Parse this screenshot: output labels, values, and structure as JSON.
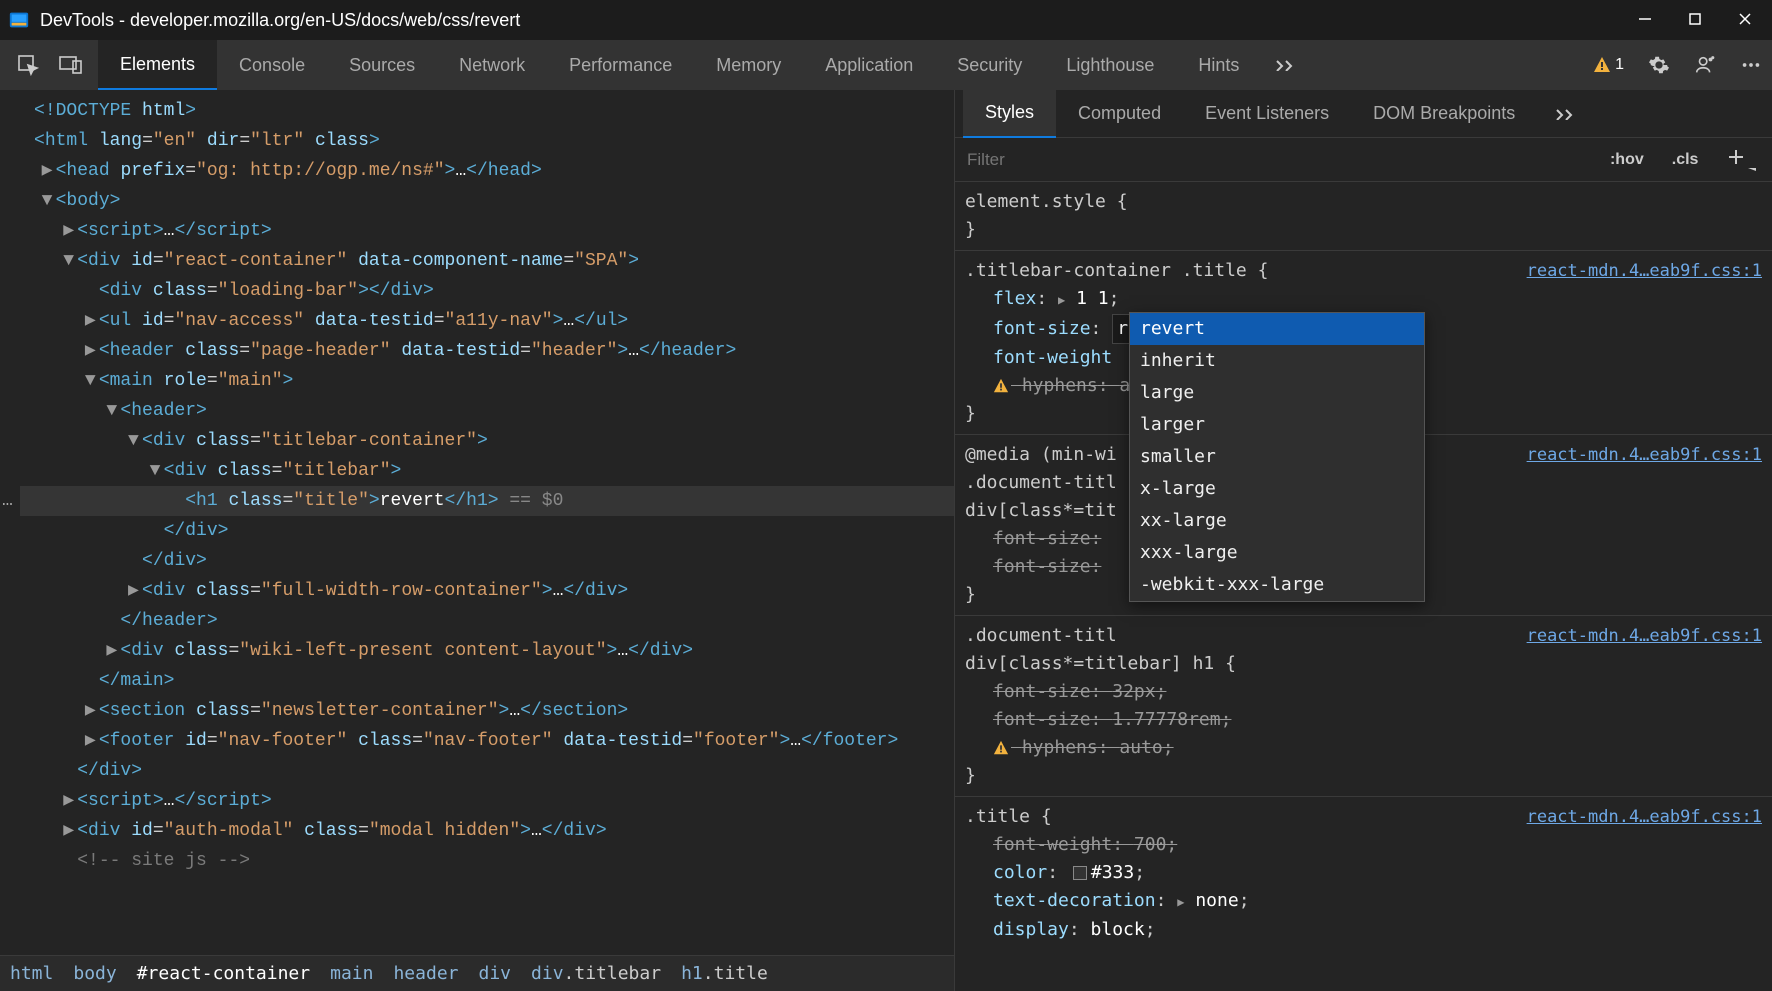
{
  "window": {
    "title": "DevTools - developer.mozilla.org/en-US/docs/web/css/revert"
  },
  "mainTabs": [
    "Elements",
    "Console",
    "Sources",
    "Network",
    "Performance",
    "Memory",
    "Application",
    "Security",
    "Lighthouse",
    "Hints"
  ],
  "mainTabsActive": 0,
  "issueCount": "1",
  "dom": [
    {
      "indent": 0,
      "arrow": "",
      "html": "<!DOCTYPE html>"
    },
    {
      "indent": 0,
      "arrow": "",
      "html": "<html lang=\"en\" dir=\"ltr\" class>"
    },
    {
      "indent": 1,
      "arrow": "▶",
      "html": "<head prefix=\"og: http://ogp.me/ns#\">…</head>"
    },
    {
      "indent": 1,
      "arrow": "▼",
      "html": "<body>"
    },
    {
      "indent": 2,
      "arrow": "▶",
      "html": "<script>…</script>"
    },
    {
      "indent": 2,
      "arrow": "▼",
      "html": "<div id=\"react-container\" data-component-name=\"SPA\">"
    },
    {
      "indent": 3,
      "arrow": "",
      "html": "<div class=\"loading-bar\"></div>"
    },
    {
      "indent": 3,
      "arrow": "▶",
      "html": "<ul id=\"nav-access\" data-testid=\"a11y-nav\">…</ul>"
    },
    {
      "indent": 3,
      "arrow": "▶",
      "html": "<header class=\"page-header\" data-testid=\"header\">…</header>"
    },
    {
      "indent": 3,
      "arrow": "▼",
      "html": "<main role=\"main\">"
    },
    {
      "indent": 4,
      "arrow": "▼",
      "html": "<header>"
    },
    {
      "indent": 5,
      "arrow": "▼",
      "html": "<div class=\"titlebar-container\">"
    },
    {
      "indent": 6,
      "arrow": "▼",
      "html": "<div class=\"titlebar\">"
    },
    {
      "indent": 7,
      "arrow": "",
      "html": "<h1 class=\"title\">revert</h1>",
      "selected": true,
      "selmark": " == $0"
    },
    {
      "indent": 6,
      "arrow": "",
      "html": "</div>"
    },
    {
      "indent": 5,
      "arrow": "",
      "html": "</div>"
    },
    {
      "indent": 5,
      "arrow": "▶",
      "html": "<div class=\"full-width-row-container\">…</div>"
    },
    {
      "indent": 4,
      "arrow": "",
      "html": "</header>"
    },
    {
      "indent": 4,
      "arrow": "▶",
      "html": "<div class=\"wiki-left-present content-layout\">…</div>"
    },
    {
      "indent": 3,
      "arrow": "",
      "html": "</main>"
    },
    {
      "indent": 3,
      "arrow": "▶",
      "html": "<section class=\"newsletter-container\">…</section>"
    },
    {
      "indent": 3,
      "arrow": "▶",
      "html": "<footer id=\"nav-footer\" class=\"nav-footer\" data-testid=\"footer\">…</footer>"
    },
    {
      "indent": 2,
      "arrow": "",
      "html": "</div>"
    },
    {
      "indent": 2,
      "arrow": "▶",
      "html": "<script>…</script>"
    },
    {
      "indent": 2,
      "arrow": "▶",
      "html": "<div id=\"auth-modal\" class=\"modal hidden\">…</div>"
    },
    {
      "indent": 2,
      "arrow": "",
      "html": "<!-- site js -->",
      "comment": true
    }
  ],
  "breadcrumb": [
    {
      "t": "html",
      "suff": ""
    },
    {
      "t": "body",
      "suff": ""
    },
    {
      "t": "#react-container",
      "suff": "",
      "sel": true
    },
    {
      "t": "main",
      "suff": ""
    },
    {
      "t": "header",
      "suff": ""
    },
    {
      "t": "div",
      "suff": ""
    },
    {
      "t": "div",
      "suff": ".titlebar"
    },
    {
      "t": "h1",
      "suff": ".title"
    }
  ],
  "subTabs": [
    "Styles",
    "Computed",
    "Event Listeners",
    "DOM Breakpoints"
  ],
  "subTabsActive": 0,
  "filter": {
    "placeholder": "Filter",
    "hov": ":hov",
    "cls": ".cls"
  },
  "autocomplete": {
    "typed": "r",
    "items": [
      "revert",
      "inherit",
      "large",
      "larger",
      "smaller",
      "x-large",
      "xx-large",
      "xxx-large",
      "-webkit-xxx-large"
    ],
    "highlight": 0
  },
  "sourceLink": "react-mdn.4…eab9f.css:1",
  "styles": {
    "elementStyle": "element.style {",
    "r1": {
      "sel": ".titlebar-container .title {",
      "flex": {
        "name": "flex",
        "val": "1 1"
      },
      "fontSize": {
        "name": "font-size"
      },
      "fontWeight": {
        "name": "font-weight"
      },
      "hyphens": {
        "name": "hyphens",
        "val": "auto"
      }
    },
    "r2": {
      "media": "@media (min-wi",
      "sel1": ".document-titl",
      "sel2": "div[class*=tit",
      "fs1": {
        "name": "font-size"
      },
      "fs2": {
        "name": "font-size"
      }
    },
    "r3": {
      "sel1": ".document-titl",
      "sel2": "div[class*=titlebar] h1 {",
      "fs1": {
        "name": "font-size",
        "val": "32px"
      },
      "fs2": {
        "name": "font-size",
        "val": "1.77778rem"
      },
      "hyphens": {
        "name": "hyphens",
        "val": "auto"
      }
    },
    "r4": {
      "sel": ".title {",
      "fw": {
        "name": "font-weight",
        "val": "700"
      },
      "color": {
        "name": "color",
        "val": "#333"
      },
      "td": {
        "name": "text-decoration",
        "val": "none"
      },
      "disp": {
        "name": "display",
        "val": "block"
      }
    }
  }
}
